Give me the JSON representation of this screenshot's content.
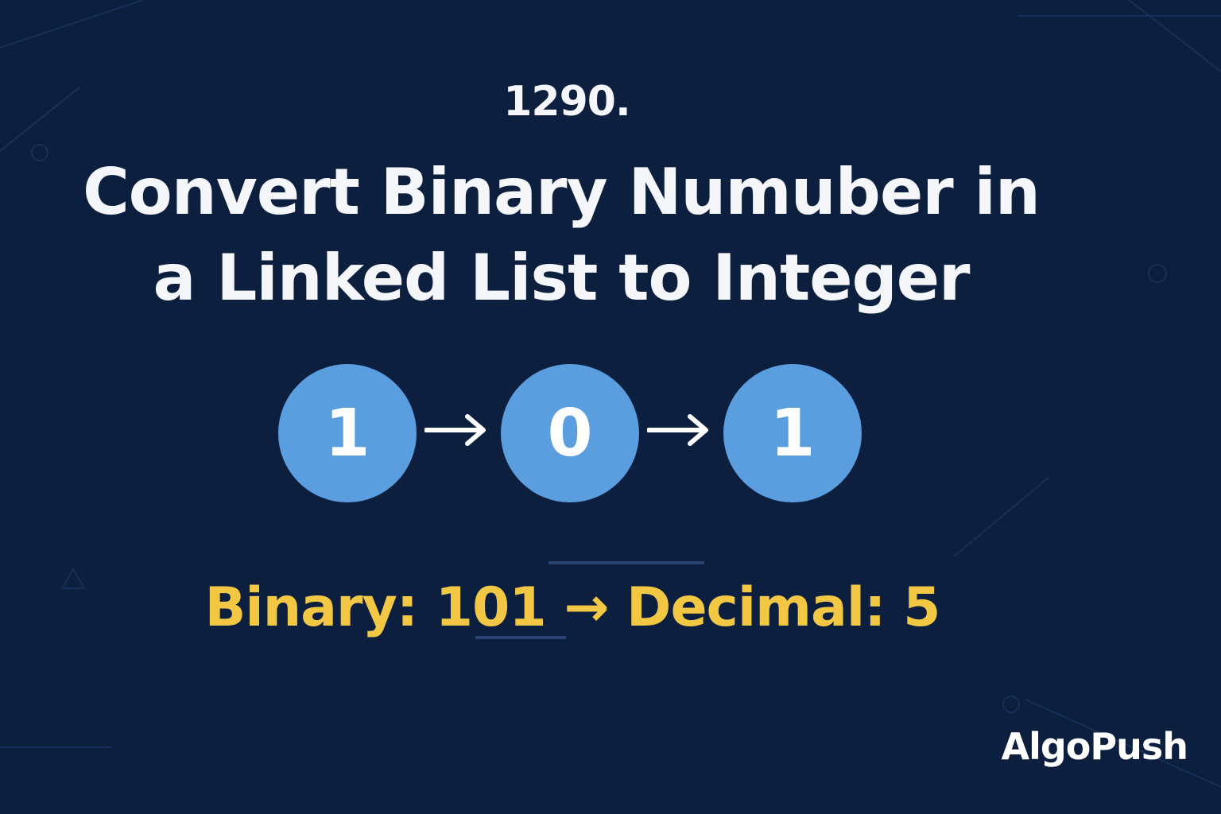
{
  "problem": {
    "number": "1290.",
    "title_line1": "Convert Binary Numuber in",
    "title_line2": "a Linked List to Integer"
  },
  "linked_list": {
    "nodes": [
      "1",
      "0",
      "1"
    ],
    "node_color": "#5b9ee0",
    "arrow_icon": "right-arrow-icon"
  },
  "result": {
    "text": "Binary: 101 → Decimal: 5",
    "color": "#f2c744"
  },
  "brand": {
    "name": "AlgoPush"
  },
  "theme": {
    "background": "#0c1f3f",
    "text": "#f4f6fa"
  }
}
